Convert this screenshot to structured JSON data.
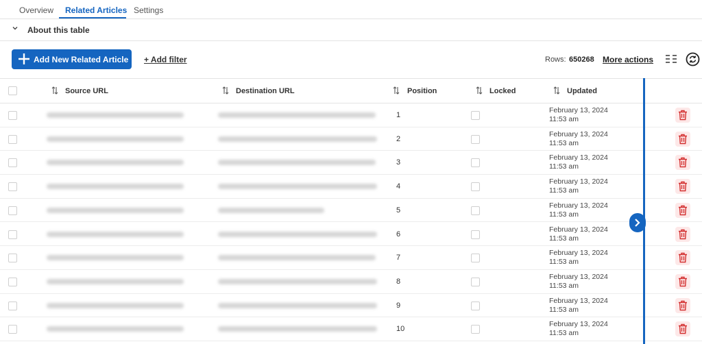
{
  "tabs": [
    {
      "label": "Overview"
    },
    {
      "label": "Related Articles"
    },
    {
      "label": "Settings"
    }
  ],
  "about": {
    "label": "About this table"
  },
  "toolbar": {
    "add_label": "Add New Related Article",
    "filter_label": "+ Add filter",
    "rows_label": "Rows:",
    "rows_count": "650268",
    "more_actions": "More actions"
  },
  "table": {
    "columns": [
      "Source URL",
      "Destination URL",
      "Position",
      "Locked",
      "Updated"
    ],
    "rows": [
      {
        "position": "1",
        "date": "February 13, 2024",
        "time": "11:53 am"
      },
      {
        "position": "2",
        "date": "February 13, 2024",
        "time": "11:53 am"
      },
      {
        "position": "3",
        "date": "February 13, 2024",
        "time": "11:53 am"
      },
      {
        "position": "4",
        "date": "February 13, 2024",
        "time": "11:53 am"
      },
      {
        "position": "5",
        "date": "February 13, 2024",
        "time": "11:53 am"
      },
      {
        "position": "6",
        "date": "February 13, 2024",
        "time": "11:53 am"
      },
      {
        "position": "7",
        "date": "February 13, 2024",
        "time": "11:53 am"
      },
      {
        "position": "8",
        "date": "February 13, 2024",
        "time": "11:53 am"
      },
      {
        "position": "9",
        "date": "February 13, 2024",
        "time": "11:53 am"
      },
      {
        "position": "10",
        "date": "February 13, 2024",
        "time": "11:53 am"
      }
    ]
  },
  "colors": {
    "accent": "#1565c0",
    "danger": "#d32f2f",
    "danger_bg": "#fde8e8"
  }
}
